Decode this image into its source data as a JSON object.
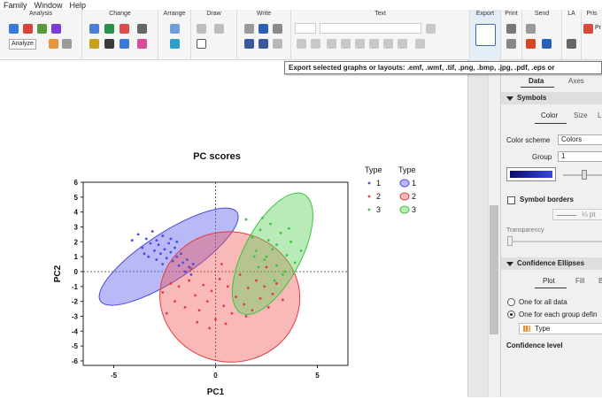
{
  "menu": [
    "Family",
    "Window",
    "Help"
  ],
  "ribbon": {
    "groups": [
      "Analysis",
      "Change",
      "Arrange",
      "Draw",
      "Write",
      "Text",
      "Export",
      "Print",
      "Send",
      "LA",
      "Pris"
    ],
    "analyze_label": "Analyze",
    "print_short": "Pr"
  },
  "tooltip": "Export selected graphs or layouts:  .emf, .wmf,  .tif, .png, .bmp, .jpg, .pdf, .eps or",
  "chart_data": {
    "type": "scatter",
    "title": "PC scores",
    "xlabel": "PC1",
    "ylabel": "PC2",
    "xlim": [
      -6.5,
      6.5
    ],
    "ylim": [
      -6.3,
      6
    ],
    "xticks": [
      "-5",
      "0",
      "5"
    ],
    "yticks": [
      "6",
      "5",
      "4",
      "3",
      "2",
      "1",
      "0",
      "-1",
      "-2",
      "-3",
      "-4",
      "-5",
      "-6"
    ],
    "legend": {
      "placement": "top-right",
      "header_points": "Type",
      "header_ellipses": "Type",
      "entries": [
        "1",
        "2",
        "3"
      ]
    },
    "series": [
      {
        "name": "1",
        "color": "#4a4ae0",
        "fill": "rgba(100,100,240,0.45)",
        "ellipse": {
          "cx": -2.3,
          "cy": 1.0,
          "rx": 4.0,
          "ry": 1.6,
          "angle": -33
        },
        "points": [
          [
            -4.1,
            2.1
          ],
          [
            -3.8,
            2.5
          ],
          [
            -3.6,
            1.6
          ],
          [
            -3.4,
            2.2
          ],
          [
            -3.2,
            1.9
          ],
          [
            -3.1,
            2.7
          ],
          [
            -3.0,
            1.4
          ],
          [
            -2.9,
            2.1
          ],
          [
            -2.8,
            1.8
          ],
          [
            -2.7,
            1.2
          ],
          [
            -2.6,
            2.4
          ],
          [
            -2.5,
            1.5
          ],
          [
            -2.4,
            0.9
          ],
          [
            -2.3,
            1.9
          ],
          [
            -2.2,
            1.3
          ],
          [
            -2.1,
            0.7
          ],
          [
            -2.0,
            1.6
          ],
          [
            -1.9,
            1.0
          ],
          [
            -1.8,
            0.4
          ],
          [
            -1.7,
            1.2
          ],
          [
            -1.6,
            0.6
          ],
          [
            -1.5,
            0.0
          ],
          [
            -1.4,
            0.8
          ],
          [
            -1.3,
            0.3
          ],
          [
            -1.2,
            -0.2
          ],
          [
            -1.1,
            0.5
          ],
          [
            -3.3,
            1.0
          ],
          [
            -2.9,
            0.8
          ],
          [
            -2.2,
            2.2
          ],
          [
            -1.9,
            2.0
          ],
          [
            -3.5,
            1.2
          ],
          [
            -2.6,
            0.5
          ]
        ]
      },
      {
        "name": "2",
        "color": "#e03c3c",
        "fill": "rgba(240,80,80,0.40)",
        "ellipse": {
          "cx": 0.7,
          "cy": -1.7,
          "rx": 3.2,
          "ry": 4.7,
          "angle": -83
        },
        "points": [
          [
            -2.6,
            -1.4
          ],
          [
            -2.2,
            -0.8
          ],
          [
            -2.0,
            -2.0
          ],
          [
            -1.8,
            -1.0
          ],
          [
            -1.5,
            -2.4
          ],
          [
            -1.3,
            -0.6
          ],
          [
            -1.0,
            -1.6
          ],
          [
            -0.8,
            -2.6
          ],
          [
            -0.6,
            -0.9
          ],
          [
            -0.4,
            -2.0
          ],
          [
            -0.2,
            -1.3
          ],
          [
            0.0,
            -3.2
          ],
          [
            0.2,
            -0.5
          ],
          [
            0.4,
            -2.3
          ],
          [
            0.6,
            -1.0
          ],
          [
            0.8,
            -2.8
          ],
          [
            1.0,
            -1.7
          ],
          [
            1.2,
            -0.2
          ],
          [
            1.4,
            -2.2
          ],
          [
            1.6,
            -1.1
          ],
          [
            1.8,
            -2.6
          ],
          [
            2.0,
            -0.6
          ],
          [
            2.2,
            -1.8
          ],
          [
            2.4,
            -1.0
          ],
          [
            2.6,
            -2.4
          ],
          [
            2.8,
            -1.5
          ],
          [
            3.0,
            -0.8
          ],
          [
            3.3,
            -1.9
          ],
          [
            -0.9,
            -3.4
          ],
          [
            -0.3,
            -3.8
          ],
          [
            0.5,
            -3.5
          ],
          [
            1.5,
            -3.0
          ],
          [
            -1.2,
            0.2
          ],
          [
            0.3,
            0.5
          ],
          [
            2.5,
            0.3
          ],
          [
            -2.4,
            -2.8
          ]
        ]
      },
      {
        "name": "3",
        "color": "#3cc43c",
        "fill": "rgba(100,210,100,0.45)",
        "ellipse": {
          "cx": 2.8,
          "cy": 1.2,
          "rx": 3.3,
          "ry": 1.9,
          "angle": -62
        },
        "points": [
          [
            1.5,
            3.5
          ],
          [
            2.2,
            2.8
          ],
          [
            2.0,
            1.4
          ],
          [
            2.4,
            0.8
          ],
          [
            2.6,
            2.1
          ],
          [
            2.8,
            1.5
          ],
          [
            3.0,
            0.4
          ],
          [
            3.2,
            2.6
          ],
          [
            2.7,
            3.2
          ],
          [
            3.5,
            1.1
          ],
          [
            3.7,
            2.0
          ],
          [
            3.9,
            0.6
          ],
          [
            3.3,
            -0.2
          ],
          [
            2.1,
            0.3
          ],
          [
            1.8,
            2.3
          ],
          [
            3.0,
            1.8
          ],
          [
            2.5,
            1.0
          ],
          [
            3.6,
            2.9
          ],
          [
            4.2,
            1.4
          ],
          [
            2.9,
            -0.6
          ],
          [
            2.3,
            3.6
          ],
          [
            3.4,
            0.0
          ],
          [
            1.9,
            1.0
          ]
        ]
      }
    ]
  },
  "panel": {
    "tab_data": "Data",
    "tab_axes": "Axes",
    "symbols_header": "Symbols",
    "subtab_color": "Color",
    "subtab_size": "Size",
    "subtab_more": "L",
    "color_scheme_label": "Color scheme",
    "color_scheme_value": "Colors",
    "group_label": "Group",
    "group_value": "1",
    "symbol_borders_label": "Symbol borders",
    "pt_value": "¼ pt",
    "transparency_label": "Transparency",
    "ellipses_header": "Confidence Ellipses",
    "subtab_plot": "Plot",
    "subtab_fill": "Fill",
    "subtab_b": "B",
    "radio_all": "One for all data",
    "radio_each": "One for each group defin",
    "group_var": "Type",
    "confidence_level_label": "Confidence level"
  }
}
